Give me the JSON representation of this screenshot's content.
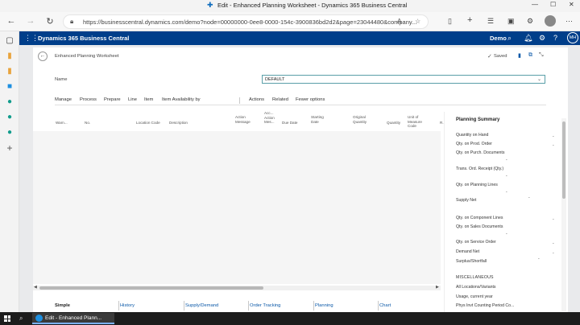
{
  "browser": {
    "window_title": "Edit - Enhanced Planning Worksheet - Dynamics 365 Business Central",
    "url": "https://businesscentral.dynamics.com/demo?node=00000000-0ee8-0000-154c-3900836bd2d2&page=23044480&company..."
  },
  "header": {
    "app_name": "Dynamics 365 Business Central",
    "company": "Demo",
    "avatar_initials": "MH"
  },
  "page": {
    "title": "Enhanced Planning Worksheet",
    "saved_label": "Saved",
    "name_label": "Name",
    "name_value": "DEFAULT"
  },
  "actions": [
    "Manage",
    "Process",
    "Prepare",
    "Line",
    "Item",
    "Item Availability by",
    "Actions",
    "Related",
    "Fewer options"
  ],
  "columns": [
    "Warn...",
    "No.",
    "Location Code",
    "Description",
    "Action Message",
    "Acc... Action Mes...",
    "Due Date",
    "Starting Date",
    "Original Quantity",
    "Quantity",
    "Unit of Measure Code",
    "R..."
  ],
  "bottom_tabs": [
    "Simple",
    "History",
    "Supply/Demand",
    "Order Tracking",
    "Planning",
    "Chart"
  ],
  "planning_summary": {
    "title": "Planning Summary",
    "items": [
      "Quantity on Hand",
      "Qty. on Prod. Order",
      "Qty. on Purch. Documents",
      "Trans. Ord. Receipt (Qty.)",
      "Qty. on Planning Lines",
      "Supply Net",
      "Qty. on Component Lines",
      "Qty. on Sales Documents",
      "Qty. on Service Order",
      "Demand Net",
      "Surplus/Shortfall",
      "MISCELLANEOUS",
      "All Locations/Variants",
      "Usage, current year",
      "Phys Invt Counting Period Co..."
    ]
  },
  "taskbar": {
    "app_label": "Edit - Enhanced Plann..."
  },
  "colors": {
    "bc_header": "#003e8a",
    "link": "#0a58a8",
    "taskbar": "#1c1c1c"
  }
}
